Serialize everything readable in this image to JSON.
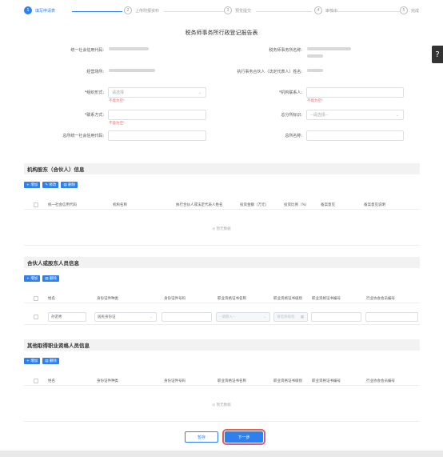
{
  "steps": [
    {
      "num": "1",
      "label": "填写申请表"
    },
    {
      "num": "2",
      "label": "上传附报资料"
    },
    {
      "num": "3",
      "label": "预览提交"
    },
    {
      "num": "4",
      "label": "审核中"
    },
    {
      "num": "5",
      "label": "完成"
    }
  ],
  "side_icon": "?",
  "form_title": "税务师事务所行政登记报告表",
  "fields": {
    "credit_code_label": "统一社会信用代码:",
    "firm_name_label": "税务师事务所名称:",
    "location_label": "经营场所:",
    "partner_label": "执行事务合伙人（法定代表人）姓名:",
    "org_form_label": "*组织形式:",
    "org_form_placeholder": "请选择",
    "org_form_error": "不能为空!",
    "contact_person_label": "*机构联系人:",
    "contact_person_error": "不能为空!",
    "contact_method_label": "*联系方式:",
    "contact_method_error": "不能为空!",
    "branch_flag_label": "总分所标识:",
    "branch_flag_placeholder": "--请选择--",
    "hq_credit_label": "总所统一社会信用代码:",
    "hq_name_label": "总所名称:"
  },
  "section1": {
    "title": "机构股东（合伙人）信息",
    "buttons": [
      "+ 增加",
      "✎ 修改",
      "▤ 删除"
    ],
    "columns": [
      "统一社会信用代码",
      "机构名称",
      "执行合伙人或法定代表人姓名",
      "投资金额（万元）",
      "投资比例（%）",
      "备案意见",
      "备案意见说明"
    ],
    "empty": "◎ 暂无数据"
  },
  "section2": {
    "title": "合伙人或股东人员信息",
    "buttons": [
      "+ 增加",
      "▤ 删除"
    ],
    "columns": [
      "姓名",
      "身份证件种类",
      "身份证件号码",
      "职业资格证书名称",
      "职业资格证书级别",
      "职业资格证书编号",
      "行业协会会员编号"
    ],
    "row": {
      "name": "孙诺秀",
      "id_type": "居民身份证",
      "cert_name": "--请输入--",
      "cert_level": "请选择级别"
    }
  },
  "section3": {
    "title": "其他取得职业资格人员信息",
    "buttons": [
      "+ 增加",
      "▤ 删除"
    ],
    "columns": [
      "姓名",
      "身份证件种类",
      "身份证件号码",
      "职业资格证书名称",
      "职业资格证书级别",
      "职业资格证书编号",
      "行业协会会员编号"
    ],
    "empty": "◎ 暂无数据"
  },
  "footer": {
    "save": "暂存",
    "next": "下一步"
  },
  "colors": {
    "primary": "#2f80ed",
    "error": "#f56c6c",
    "highlight": "#e65d5d"
  }
}
